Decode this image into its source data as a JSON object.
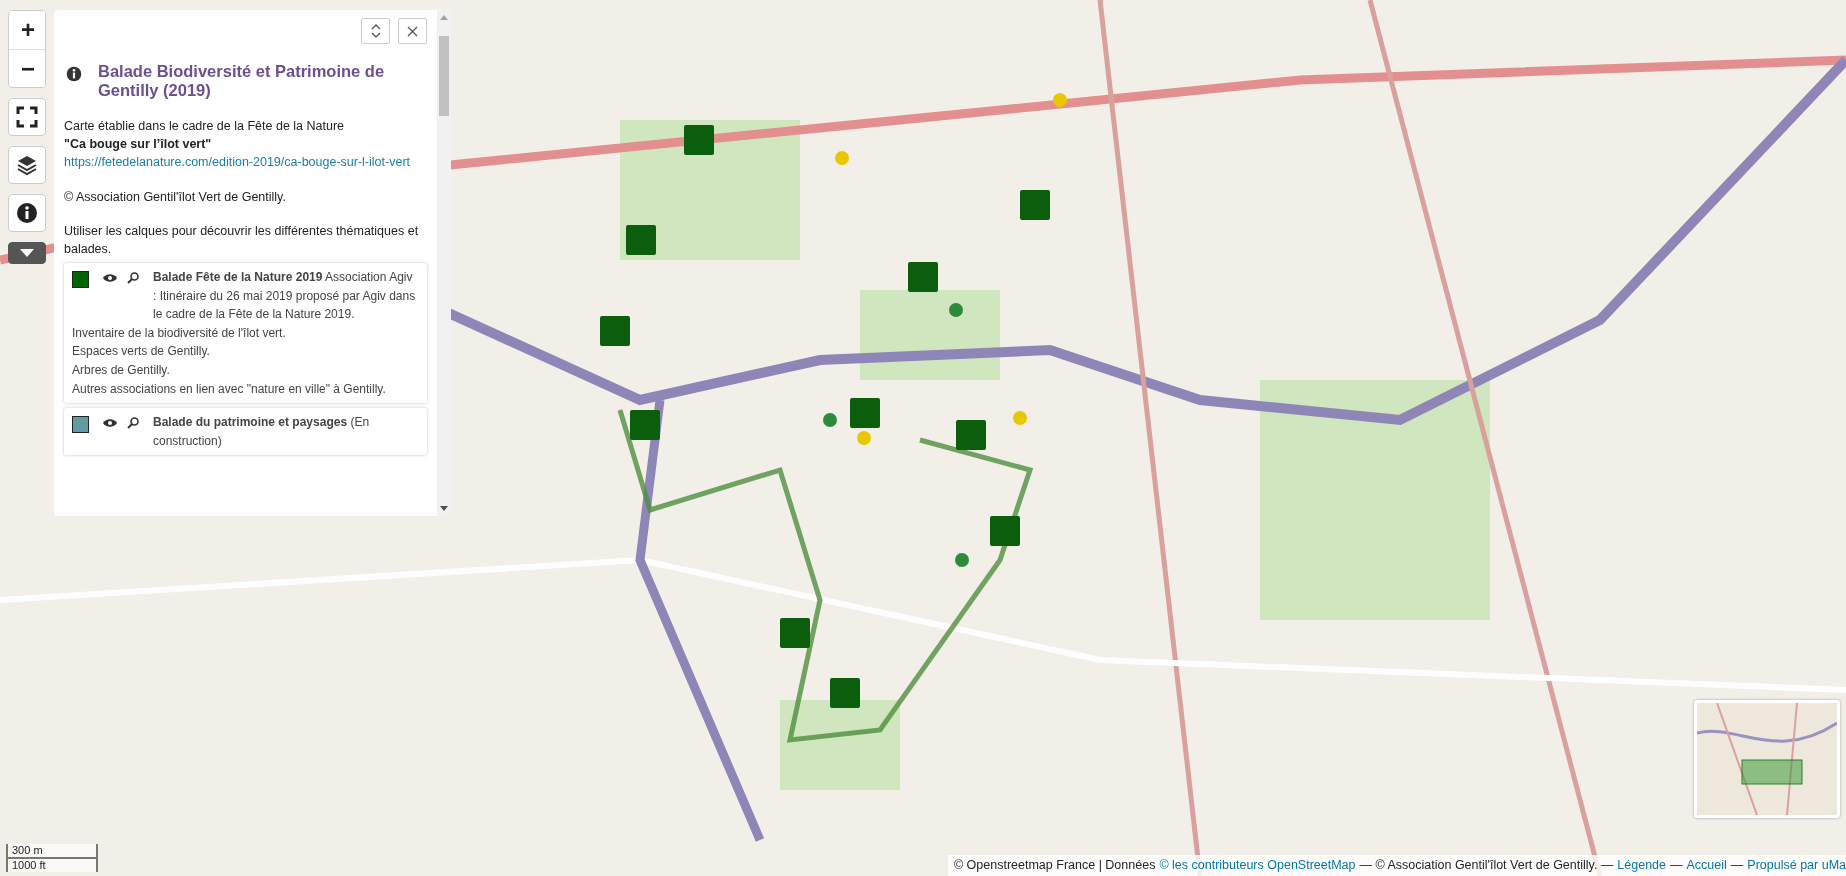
{
  "map_controls": {
    "zoom_in": "+",
    "zoom_out": "−"
  },
  "panel": {
    "title": "Balade Biodiversité et Patrimoine de Gentilly (2019)",
    "intro": [
      {
        "kind": "text",
        "text": "Carte établie dans le cadre de la Fête de la Nature"
      },
      {
        "kind": "bold",
        "text": "\"Ca bouge sur l’îlot vert\""
      },
      {
        "kind": "link",
        "text": "https://fetedelanature.com/edition-2019/ca-bouge-sur-l-ilot-vert"
      },
      {
        "kind": "gap"
      },
      {
        "kind": "text",
        "text": "© Association Gentil'îlot Vert de Gentilly."
      },
      {
        "kind": "gap"
      },
      {
        "kind": "text",
        "text": "Utiliser les calques pour découvrir les différentes thématiques et balades."
      }
    ],
    "layers": [
      {
        "color": "#006400",
        "title": "Balade Fête de la Nature 2019",
        "description": [
          "Association Agiv : Itinéraire du 26 mai 2019 proposé par Agiv dans le cadre de la Fête de la Nature 2019.",
          "Inventaire de la biodiversité de l'îlot vert.",
          "Espaces verts de Gentilly.",
          "Arbres de Gentilly.",
          "Autres associations en lien avec \"nature en ville\" à Gentilly."
        ]
      },
      {
        "color": "#5f9ea0",
        "title": "Balade du patrimoine et paysages",
        "description": [
          "(En construction)"
        ]
      }
    ]
  },
  "scale": {
    "metric": "300 m",
    "imperial": "1000 ft"
  },
  "attribution": [
    {
      "kind": "text",
      "text": "© Openstreetmap France | Données"
    },
    {
      "kind": "link",
      "text": "© les contributeurs OpenStreetMap"
    },
    {
      "kind": "text",
      "text": "— © Association Gentil'îlot Vert de Gentilly. —"
    },
    {
      "kind": "link",
      "text": "Légende"
    },
    {
      "kind": "text",
      "text": "—"
    },
    {
      "kind": "link",
      "text": "Accueil"
    },
    {
      "kind": "text",
      "text": "—"
    },
    {
      "kind": "link",
      "text": "Propulsé par uMa"
    }
  ]
}
